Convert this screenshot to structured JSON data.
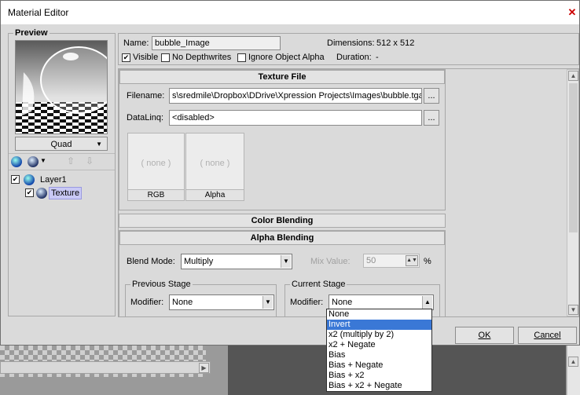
{
  "window": {
    "title": "Material Editor",
    "close_glyph": "✕"
  },
  "preview": {
    "group_title": "Preview",
    "shape_select": "Quad",
    "toolbar": [
      "layer-add-icon",
      "texture-add-icon",
      "move-up-icon",
      "move-down-icon"
    ],
    "tree": [
      {
        "label": "Layer1",
        "checked": true
      },
      {
        "label": "Texture",
        "checked": true
      }
    ]
  },
  "header": {
    "name_label": "Name:",
    "name_value": "bubble_Image",
    "dimensions_label": "Dimensions:",
    "dimensions_value": "512 x 512",
    "visible_label": "Visible",
    "visible_checked": true,
    "no_depthwrites_label": "No Depthwrites",
    "ignore_alpha_label": "Ignore Object Alpha",
    "duration_label": "Duration:",
    "duration_value": "-"
  },
  "texture_file": {
    "section_title": "Texture File",
    "filename_label": "Filename:",
    "filename_value": "s\\sredmile\\Dropbox\\DDrive\\Xpression Projects\\Images\\bubble.tga",
    "browse_label": "...",
    "datalinq_label": "DataLinq:",
    "datalinq_value": "<disabled>",
    "thumbs": [
      {
        "placeholder": "( none )",
        "caption": "RGB"
      },
      {
        "placeholder": "( none )",
        "caption": "Alpha"
      }
    ]
  },
  "color_blending": {
    "section_title": "Color Blending"
  },
  "alpha_blending": {
    "section_title": "Alpha Blending",
    "blend_mode_label": "Blend Mode:",
    "blend_mode_value": "Multiply",
    "mix_value_label": "Mix Value:",
    "mix_value": "50",
    "mix_unit": "%",
    "previous_stage": {
      "title": "Previous Stage",
      "modifier_label": "Modifier:",
      "modifier_value": "None"
    },
    "current_stage": {
      "title": "Current Stage",
      "modifier_label": "Modifier:",
      "modifier_value": "None",
      "options": [
        "None",
        "Invert",
        "x2 (multiply by 2)",
        "x2 + Negate",
        "Bias",
        "Bias + Negate",
        "Bias + x2",
        "Bias + x2 + Negate"
      ],
      "highlighted_index": 1
    }
  },
  "footer": {
    "ok_label": "OK",
    "cancel_label": "Cancel"
  },
  "colors": {
    "highlight": "#3a78d6",
    "tree_selected": "#c9c9f5",
    "close": "#cc0000"
  }
}
